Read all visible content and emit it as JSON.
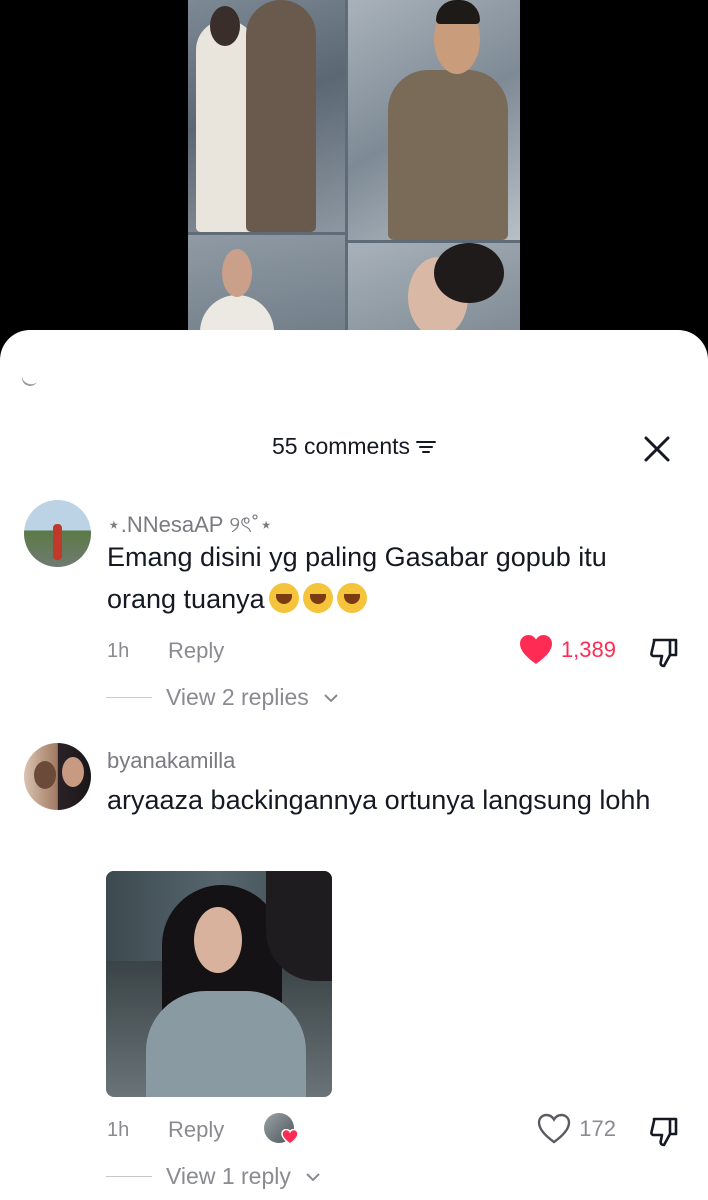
{
  "header": {
    "comment_count_label": "55 comments"
  },
  "comments": [
    {
      "username": "⋆.NNesaAP ୨ৎ˚⋆",
      "text": "Emang disini yg paling Gasabar gopub itu orang tuanya",
      "emoji_count": 3,
      "emoji": "loudly-crying-face",
      "time": "1h",
      "reply_label": "Reply",
      "likes": "1,389",
      "liked": true,
      "view_replies": "View 2 replies"
    },
    {
      "username": "byanakamilla",
      "text": "aryaaza backingannya ortunya langsung lohh",
      "time": "1h",
      "reply_label": "Reply",
      "likes": "172",
      "liked": false,
      "liked_by_creator": true,
      "view_replies": "View 1 reply"
    }
  ],
  "colors": {
    "like_active": "#fe2c55",
    "text_primary": "#161823",
    "text_secondary": "#8a8b91"
  }
}
